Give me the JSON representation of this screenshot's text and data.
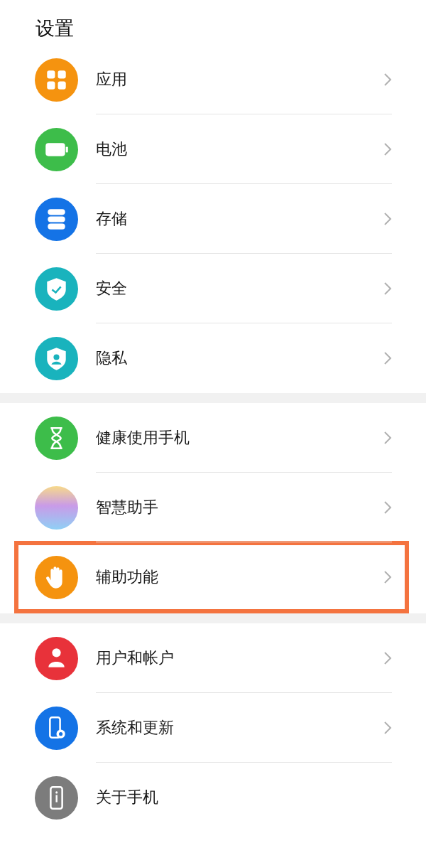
{
  "title": "设置",
  "groups": [
    {
      "items": [
        {
          "label": "应用",
          "kind": "apps",
          "color": "#f5930f",
          "chevron": true,
          "highlighted": false
        },
        {
          "label": "电池",
          "kind": "battery",
          "color": "#3dbd4a",
          "chevron": true,
          "highlighted": false
        },
        {
          "label": "存储",
          "kind": "storage",
          "color": "#1473e6",
          "chevron": true,
          "highlighted": false
        },
        {
          "label": "安全",
          "kind": "shield",
          "color": "#19b3bd",
          "chevron": true,
          "highlighted": false
        },
        {
          "label": "隐私",
          "kind": "privacy",
          "color": "#19b3bd",
          "chevron": true,
          "highlighted": false
        }
      ]
    },
    {
      "items": [
        {
          "label": "健康使用手机",
          "kind": "hourglass",
          "color": "#3dbd4a",
          "chevron": true,
          "highlighted": false
        },
        {
          "label": "智慧助手",
          "kind": "orb",
          "color": "#c99be8",
          "chevron": true,
          "highlighted": false
        },
        {
          "label": "辅助功能",
          "kind": "hand",
          "color": "#f5930f",
          "chevron": true,
          "highlighted": true
        }
      ]
    },
    {
      "items": [
        {
          "label": "用户和帐户",
          "kind": "user",
          "color": "#e8323a",
          "chevron": true,
          "highlighted": false
        },
        {
          "label": "系统和更新",
          "kind": "phone-gear",
          "color": "#1473e6",
          "chevron": true,
          "highlighted": false
        },
        {
          "label": "关于手机",
          "kind": "phone-info",
          "color": "#7c7c7c",
          "chevron": false,
          "highlighted": false
        }
      ]
    }
  ]
}
